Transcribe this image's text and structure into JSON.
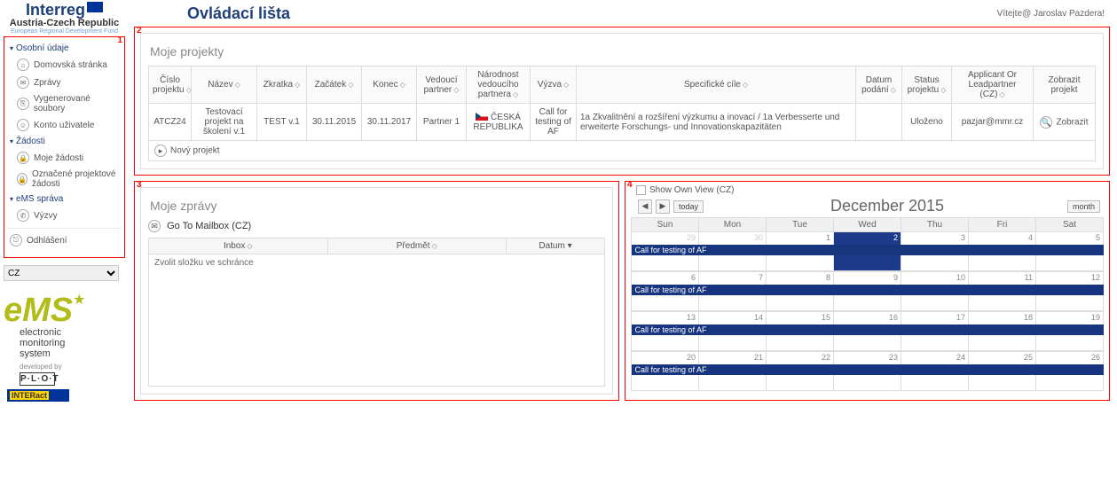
{
  "header": {
    "logo_main": "Interreg",
    "logo_sub": "Austria-Czech Republic",
    "logo_sub2": "European Regional Development Fund",
    "page_title": "Ovládací lišta",
    "welcome": "Vítejte@ Jaroslav Pazdera!"
  },
  "nav": {
    "corner": "1",
    "group_personal": "Osobní údaje",
    "items_personal": [
      {
        "label": "Domovská stránka",
        "icon": "⌂"
      },
      {
        "label": "Zprávy",
        "icon": "✉"
      },
      {
        "label": "Vygenerované soubory",
        "icon": "⎘"
      },
      {
        "label": "Konto uživatele",
        "icon": "☺"
      }
    ],
    "group_app": "Žádosti",
    "items_app": [
      {
        "label": "Moje žádosti",
        "icon": "🔒"
      },
      {
        "label": "Označené projektové žádosti",
        "icon": "🔒"
      }
    ],
    "group_ems": "eMS správa",
    "items_ems": [
      {
        "label": "Výzvy",
        "icon": "✆"
      }
    ],
    "logout": "Odhlášení"
  },
  "lang": {
    "selected": "CZ"
  },
  "ems_logo": {
    "title": "eMS",
    "tag1": "electronic",
    "tag2": "monitoring",
    "tag3": "system",
    "dev": "developed by",
    "plot": "P·L·O·T",
    "interact": "INTERact"
  },
  "projects_panel": {
    "corner": "2",
    "heading": "Moje projekty",
    "columns": [
      "Číslo projektu",
      "Název",
      "Zkratka",
      "Začátek",
      "Konec",
      "Vedoucí partner",
      "Národnost vedoucího partnera",
      "Výzva",
      "Specifické cíle",
      "Datum podání",
      "Status projektu",
      "Applicant Or Leadpartner (CZ)",
      "Zobrazit projekt"
    ],
    "row": {
      "id": "ATCZ24",
      "name": "Testovací projekt na školení v.1",
      "acronym": "TEST v.1",
      "start": "30.11.2015",
      "end": "30.11.2017",
      "lead": "Partner 1",
      "nationality": "ČESKÁ REPUBLIKA",
      "call": "Call for testing of AF",
      "objectives": "1a Zkvalitnění a rozšíření výzkumu a inovací / 1a Verbesserte und erweiterte Forschungs- und Innovationskapazitäten",
      "submitted": "",
      "status": "Uloženo",
      "applicant": "pazjar@mmr.cz",
      "show": "Zobrazit"
    },
    "new_project": "Nový projekt"
  },
  "messages_panel": {
    "corner": "3",
    "heading": "Moje zprávy",
    "goto": "Go To Mailbox (CZ)",
    "tabs": {
      "inbox": "Inbox",
      "subject": "Předmět",
      "date": "Datum"
    },
    "body": "Zvolit složku ve schránce"
  },
  "calendar_panel": {
    "corner": "4",
    "show_own": "Show Own View (CZ)",
    "today": "today",
    "month_btn": "month",
    "title": "December 2015",
    "days": [
      "Sun",
      "Mon",
      "Tue",
      "Wed",
      "Thu",
      "Fri",
      "Sat"
    ],
    "event": "Call for testing of AF",
    "weeks": [
      [
        {
          "n": "29",
          "o": true
        },
        {
          "n": "30",
          "o": true
        },
        {
          "n": "1"
        },
        {
          "n": "2",
          "sel": true
        },
        {
          "n": "3"
        },
        {
          "n": "4"
        },
        {
          "n": "5"
        }
      ],
      [
        {
          "n": "6"
        },
        {
          "n": "7"
        },
        {
          "n": "8"
        },
        {
          "n": "9"
        },
        {
          "n": "10"
        },
        {
          "n": "11"
        },
        {
          "n": "12"
        }
      ],
      [
        {
          "n": "13"
        },
        {
          "n": "14"
        },
        {
          "n": "15"
        },
        {
          "n": "16"
        },
        {
          "n": "17"
        },
        {
          "n": "18"
        },
        {
          "n": "19"
        }
      ],
      [
        {
          "n": "20"
        },
        {
          "n": "21"
        },
        {
          "n": "22"
        },
        {
          "n": "23"
        },
        {
          "n": "24"
        },
        {
          "n": "25"
        },
        {
          "n": "26"
        }
      ]
    ]
  }
}
